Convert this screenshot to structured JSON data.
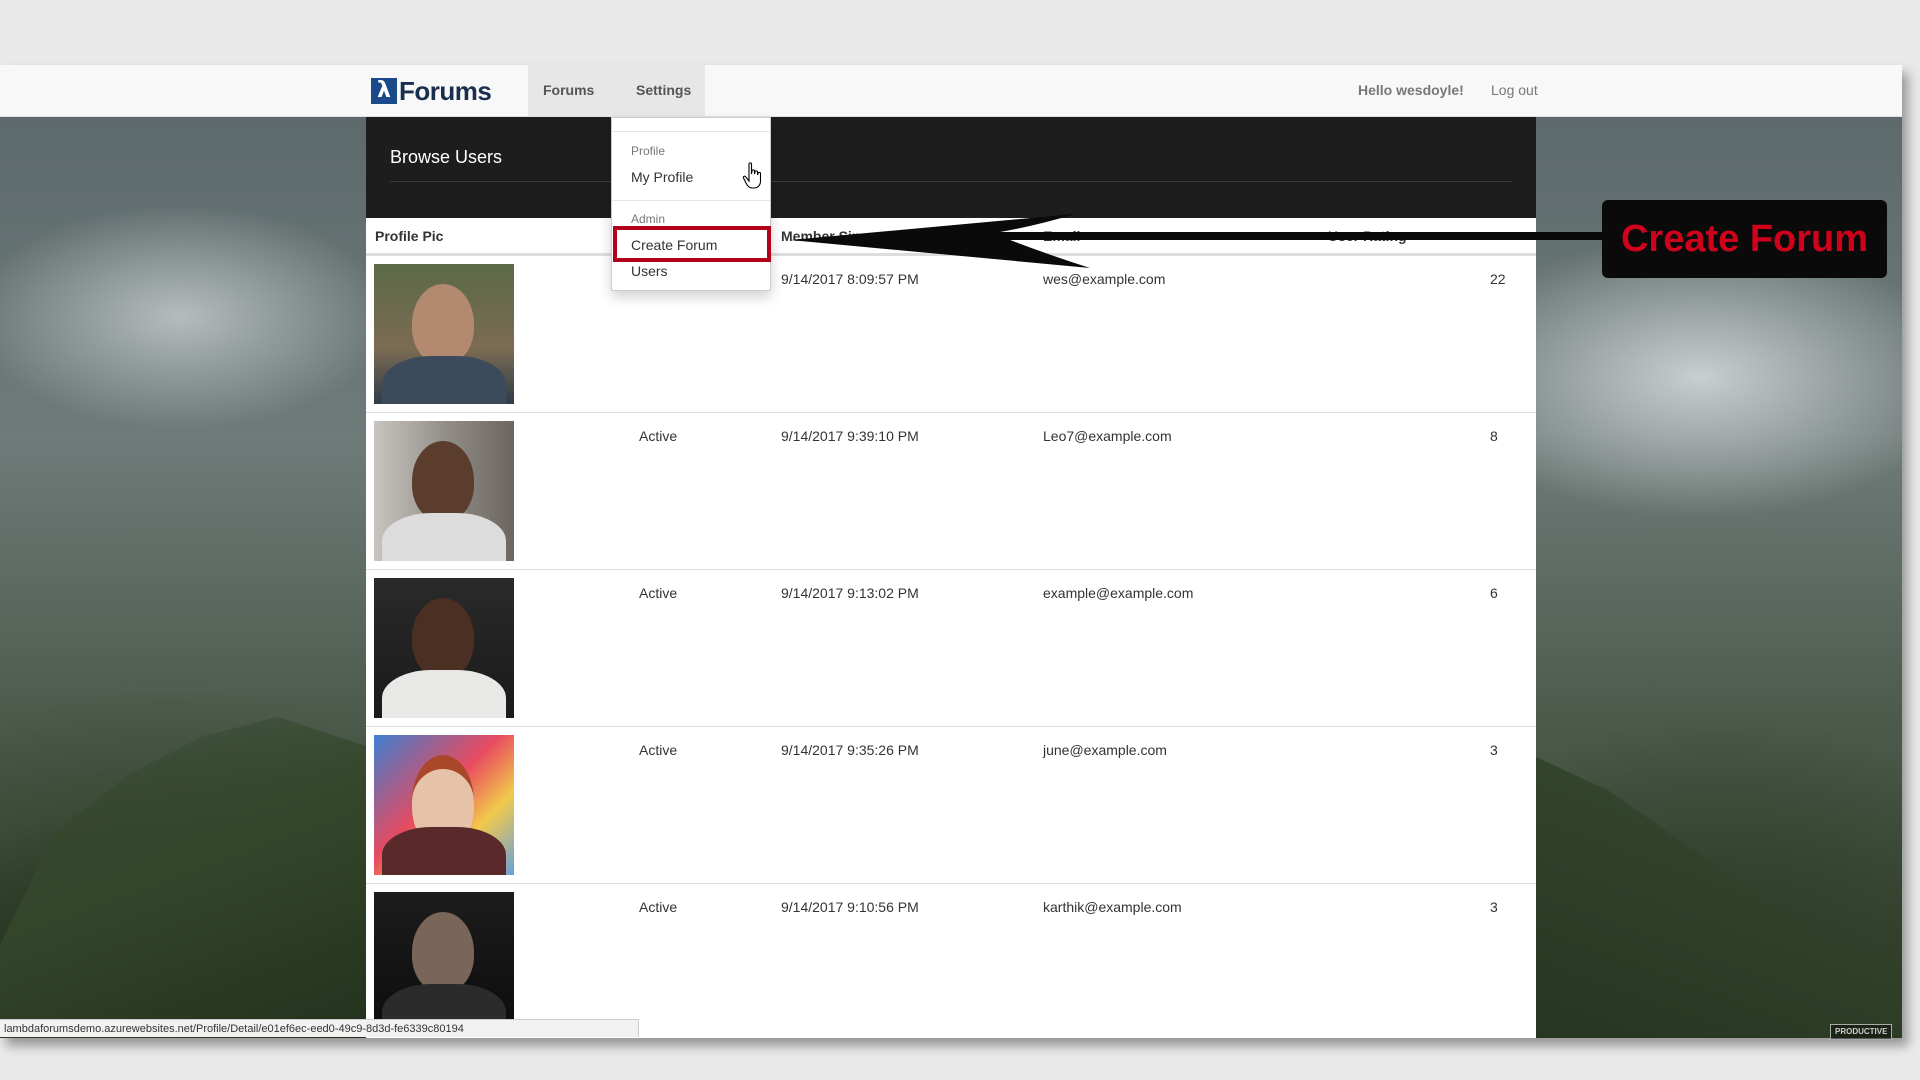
{
  "navbar": {
    "brand_symbol": "λ",
    "brand_text": "Forums",
    "forums_label": "Forums",
    "settings_label": "Settings",
    "greeting": "Hello wesdoyle!",
    "logout_label": "Log out"
  },
  "page": {
    "title": "Browse Users"
  },
  "table": {
    "columns": [
      "Profile Pic",
      "",
      "Member Since",
      "Email",
      "User Rating"
    ],
    "rows": [
      {
        "status": "",
        "member_since": "9/14/2017 8:09:57 PM",
        "email": "wes@example.com",
        "rating": "22"
      },
      {
        "status": "Active",
        "member_since": "9/14/2017 9:39:10 PM",
        "email": "Leo7@example.com",
        "rating": "8"
      },
      {
        "status": "Active",
        "member_since": "9/14/2017 9:13:02 PM",
        "email": "example@example.com",
        "rating": "6"
      },
      {
        "status": "Active",
        "member_since": "9/14/2017 9:35:26 PM",
        "email": "june@example.com",
        "rating": "3"
      },
      {
        "status": "Active",
        "member_since": "9/14/2017 9:10:56 PM",
        "email": "karthik@example.com",
        "rating": "3"
      }
    ]
  },
  "dropdown": {
    "profile_header": "Profile",
    "my_profile": "My Profile",
    "admin_header": "Admin",
    "create_forum": "Create Forum",
    "users": "Users"
  },
  "annotation": {
    "text": "Create Forum",
    "color": "#d0021b"
  },
  "status_bar": {
    "url": "lambdaforumsdemo.azurewebsites.net/Profile/Detail/e01ef6ec-eed0-49c9-8d3d-fe6339c80194"
  },
  "watermark": "PRODUCTIVE"
}
